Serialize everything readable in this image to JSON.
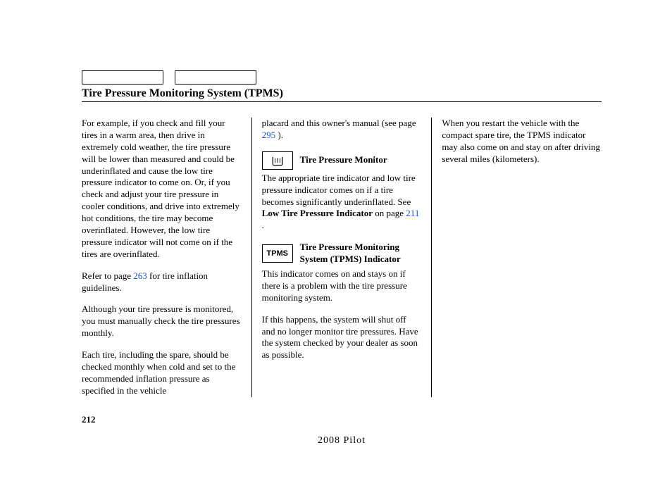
{
  "title": "Tire Pressure Monitoring System (TPMS)",
  "pageNumber": "212",
  "footer": "2008  Pilot",
  "col1": {
    "p1a": "For example, if you check and fill your tires in a warm area, then drive in extremely cold weather, the tire pressure will be lower than measured and could be underinflated and cause the low tire pressure indicator to come on. Or, if you check and adjust your tire pressure in cooler conditions, and drive into extremely hot conditions, the tire may become overinflated. However, the low tire pressure indicator will not come on if the tires are overinflated.",
    "p2a": "Refer to page ",
    "p2link": "263",
    "p2b": " for tire inflation guidelines.",
    "p3": "Although your tire pressure is monitored, you must manually check the tire pressures monthly.",
    "p4": "Each tire, including the spare, should be checked monthly when cold and set to the recommended inflation pressure as specified in the vehicle"
  },
  "col2": {
    "p1a": "placard and this owner's manual (see page ",
    "p1link": "295",
    "p1b": " ).",
    "icon1Label": "Tire Pressure Monitor",
    "p2a": "The appropriate tire indicator and low tire pressure indicator comes on if a tire becomes significantly underinflated. See ",
    "p2bold": "Low Tire Pressure Indicator",
    "p2b": " on page ",
    "p2link": "211",
    "p2c": " .",
    "icon2Text": "TPMS",
    "icon2Label": "Tire Pressure Monitoring System (TPMS) Indicator",
    "p3": "This indicator comes on and stays on if there is a problem with the tire pressure monitoring system.",
    "p4": "If this happens, the system will shut off and no longer monitor tire pressures. Have the system checked by your dealer as soon as possible."
  },
  "col3": {
    "p1": "When you restart the vehicle with the compact spare tire, the TPMS indicator may also come on and stay on after driving several miles (kilometers)."
  }
}
